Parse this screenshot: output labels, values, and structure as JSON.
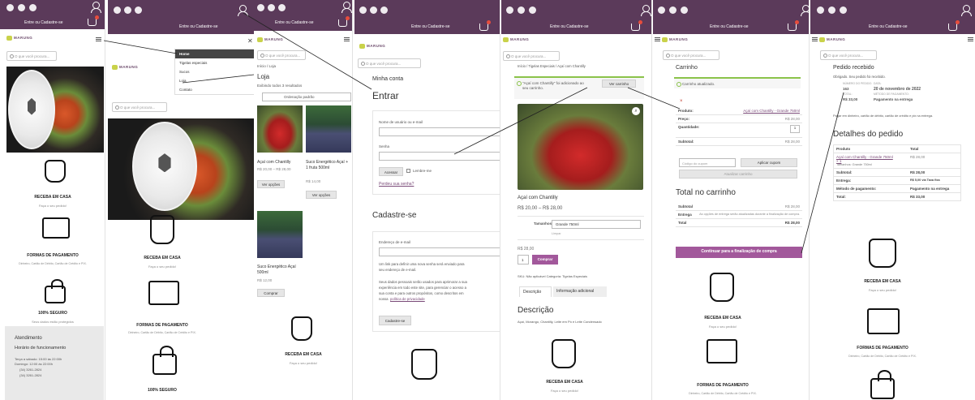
{
  "header": {
    "login_label": "Entre ou Cadastre-se",
    "logo_text": "MARUNG",
    "search_placeholder": "O que você procura..."
  },
  "menu": [
    "Home",
    "Tigelas especiais",
    "Sucos",
    "Loja",
    "Contato"
  ],
  "home": {
    "features": [
      {
        "title": "RECEBA EM CASA",
        "sub": "Faça o seu pedido!"
      },
      {
        "title": "FORMAS DE PAGAMENTO",
        "sub": "Dinheiro, Cartão de Débito, Cartão de Crédito e PIX."
      },
      {
        "title": "100% SEGURO",
        "sub": "Seus dados estão protegidos"
      }
    ],
    "footer": {
      "title": "Atendimento",
      "hours_title": "Horário de funcionamento",
      "hours_1": "Terça a sábado: 15:00 às 22:00h",
      "hours_2": "Domingo: 12:00 às 22:00h",
      "phone": "(34) 3261-2824",
      "whatsapp": "(34) 3261-2824"
    }
  },
  "shop": {
    "breadcrumb": "Início / Loja",
    "title": "Loja",
    "results": "Exibindo todos 3 resultados",
    "sort": "Ordenação padrão",
    "products": [
      {
        "name": "Açaí com Chantilly",
        "price": "R$ 20,00 – R$ 28,00",
        "button": "Ver opções"
      },
      {
        "name": "Suco Energético Açaí + 1 fruta 500ml",
        "price": "R$ 14,00",
        "button": "Ver opções"
      },
      {
        "name": "Suco Energético Açaí 500ml",
        "price": "R$ 12,00",
        "button": "Comprar"
      }
    ]
  },
  "account": {
    "breadcrumb": "Minha conta",
    "login_title": "Entrar",
    "username_label": "Nome de usuário ou e-mail",
    "password_label": "Senha",
    "login_button": "Acessar",
    "remember": "Lembre-me",
    "lost_password": "Perdeu sua senha?",
    "register_title": "Cadastre-se",
    "email_label": "Endereço de e-mail",
    "register_note_1": "Um link para definir uma nova senha será enviado para",
    "register_note_2": "seu endereço de e-mail.",
    "privacy_1": "Seus dados pessoais serão usados para aprimorar a sua",
    "privacy_2": "experiência em todo este site, para gerenciar o acesso a",
    "privacy_3": "sua conta e para outros propósitos, como descritos em",
    "privacy_4": "nossa",
    "privacy_link": "política de privacidade",
    "register_button": "Cadastre-se"
  },
  "product": {
    "breadcrumb": "Início / Tigelas Especiais / Açaí com Chantilly",
    "notice": "\"Açaí com Chantilly\" foi adicionado ao seu carrinho.",
    "view_cart": "Ver carrinho",
    "name": "Açaí com Chantilly",
    "price_range": "R$ 20,00 – R$ 28,00",
    "size_label": "Tamanhos",
    "size_value": "Grande 750ml",
    "clear": "Limpar",
    "price": "R$ 28,00",
    "qty": "1",
    "buy_button": "Comprar",
    "meta": "SKU: Não aplicável Categoria: Tigelas Especiais",
    "tab_desc": "Descrição",
    "tab_info": "Informação adicional",
    "desc_title": "Descrição",
    "desc_text": "Açaí, Morango, Chantilly, Leite em Pó e Leite Condensado"
  },
  "cart": {
    "title": "Carrinho",
    "notice": "Carrinho atualizado.",
    "product_label": "Produto:",
    "product_value": "Açaí com Chantilly - Grande 750ml",
    "price_label": "Preço:",
    "price_value": "R$ 28,00",
    "qty_label": "Quantidade:",
    "qty_value": "1",
    "subtotal_label": "Subtotal:",
    "subtotal_value": "R$ 28,00",
    "coupon_placeholder": "Código do cupom",
    "coupon_button": "Aplicar cupom",
    "update_button": "Atualizar carrinho",
    "totals_title": "Total no carrinho",
    "t_subtotal": "Subtotal",
    "t_subtotal_value": "R$ 28,00",
    "t_shipping": "Entrega",
    "t_shipping_value": "As opções de entrega serão atualizadas durante a finalização de compra.",
    "t_total": "Total",
    "t_total_value": "R$ 28,00",
    "checkout_button": "Continuar para a finalização de compra"
  },
  "order": {
    "title": "Pedido recebido",
    "thanks": "Obrigado. Seu pedido foi recebido.",
    "num_label": "NÚMERO DO PEDIDO:",
    "num": "163",
    "date_label": "DATA:",
    "date": "20 de novembro de 2022",
    "total_label": "TOTAL:",
    "total": "R$ 33,00",
    "method_label": "MÉTODO DE PAGAMENTO:",
    "method": "Pagamento na entrega",
    "pay_note": "Pagar em dinheiro, cartão de débito, cartão de crédito e pix na entrega.",
    "details_title": "Detalhes do pedido",
    "h_product": "Produto",
    "h_total": "Total",
    "item": "Açaí com Chantilly - Grande 750ml × 1",
    "item_value": "R$ 28,00",
    "sizes": "Tamanhos: Grande 750ml",
    "subtotal_label": "Subtotal:",
    "subtotal": "R$ 28,00",
    "ship_label": "Entrega:",
    "ship": "R$ 5,00 via Taxa fixa",
    "method_row_label": "Método de pagamento:",
    "method_row": "Pagamento na entrega",
    "total_row_label": "Total:",
    "total_row": "R$ 33,00"
  }
}
